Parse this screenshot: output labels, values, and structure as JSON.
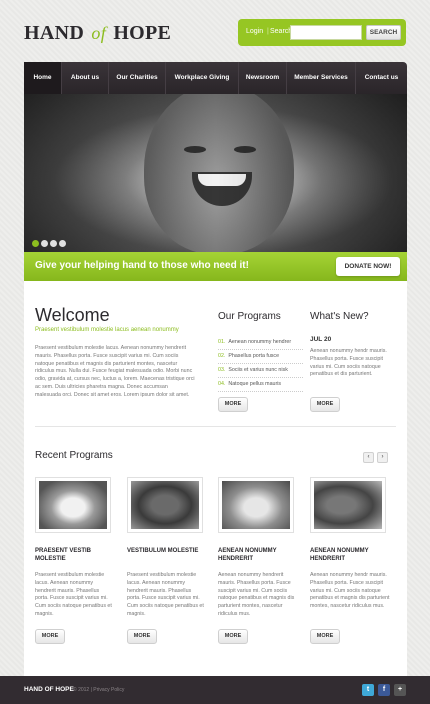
{
  "header": {
    "logo_left": "HAND",
    "logo_mid": "of",
    "logo_right": "HOPE",
    "login_label": "Login",
    "separator": "|",
    "search_link": "Search",
    "search_placeholder": "",
    "search_button": "SEARCH"
  },
  "nav": {
    "items": [
      "Home",
      "About us",
      "Our Charities",
      "Workplace Giving",
      "Newsroom",
      "Member Services",
      "Contact us"
    ]
  },
  "banner": {
    "text": "Give your helping hand to those who need it!",
    "donate": "DONATE NOW!"
  },
  "welcome": {
    "title": "Welcome",
    "subtitle": "Praesent vestibulum molestie lacus aenean nonummy",
    "body": "Praesent vestibulum molestie lacus. Aenean nonummy hendrerit mauris. Phasellus porta. Fusce suscipit varius mi. Cum sociis natoque penatibus et magnis dis parturient montes, nascetur ridiculus mus. Nulla dui. Fusce feugiat malesuada odio. Morbi nunc odio, gravida at, cursus nec, luctus a, lorem. Maecenas tristique orci ac sem. Duis ultricies pharetra magna. Donec accumsan malesuada orci. Donec sit amet eros. Lorem ipsum dolor sit amet.",
    "more": "MORE"
  },
  "programs": {
    "title": "Our Programs",
    "items": [
      {
        "num": "01.",
        "label": "Aenean nonummy hendrer"
      },
      {
        "num": "02.",
        "label": "Phasellus porta fusce"
      },
      {
        "num": "03.",
        "label": "Sociis et varius nunc nisk"
      },
      {
        "num": "04.",
        "label": "Natoque pellus mauris"
      }
    ],
    "more": "MORE"
  },
  "news": {
    "title": "What's New?",
    "date": "JUL 20",
    "body": "Aenean nonummy hendr mauris. Phasellus porta. Fusce suscipit varius mi. Cum sociis natoque penatibus et dis parturient.",
    "more": "MORE"
  },
  "recent": {
    "title": "Recent Programs",
    "prev": "‹",
    "next": "›",
    "columns": [
      {
        "title": "PRAESENT VESTIB MOLESTIE",
        "body": "Praesent vestibulum molestie lacus. Aenean nonummy hendrerit mauris. Phasellus porta. Fusce suscipit varius mi. Cum sociis natoque penatibus et magnis.",
        "more": "MORE"
      },
      {
        "title": "VESTIBULUM MOLESTIE",
        "body": "Praesent vestibulum molestie lacus. Aenean nonummy hendrerit mauris. Phasellus porta. Fusce suscipit varius mi. Cum sociis natoque penatibus et magnis.",
        "more": "MORE"
      },
      {
        "title": "AENEAN NONUMMY HENDRERIT",
        "body": "Aenean nonummy hendrerit mauris. Phasellus porta. Fusce suscipit varius mi. Cum sociis natoque penatibus et magnis dis parturient montes, nascetur ridiculus mus.",
        "more": "MORE"
      },
      {
        "title": "AENEAN NONUMMY HENDRERIT",
        "body": "Aenean nonummy hendr mauris. Phasellus porta. Fusce suscipit varius mi. Cum sociis natoque penatibus et magnis dis parturient montes, nascetur ridiculus mus.",
        "more": "MORE"
      }
    ]
  },
  "footer": {
    "brand": "HAND OF HOPE",
    "copy": "© 2012 | Privacy Policy",
    "social": [
      "t",
      "f",
      "+"
    ]
  },
  "colors": {
    "accent": "#8cbd1f",
    "nav_bg": "#2a2529",
    "footer_bg": "#322c31"
  }
}
